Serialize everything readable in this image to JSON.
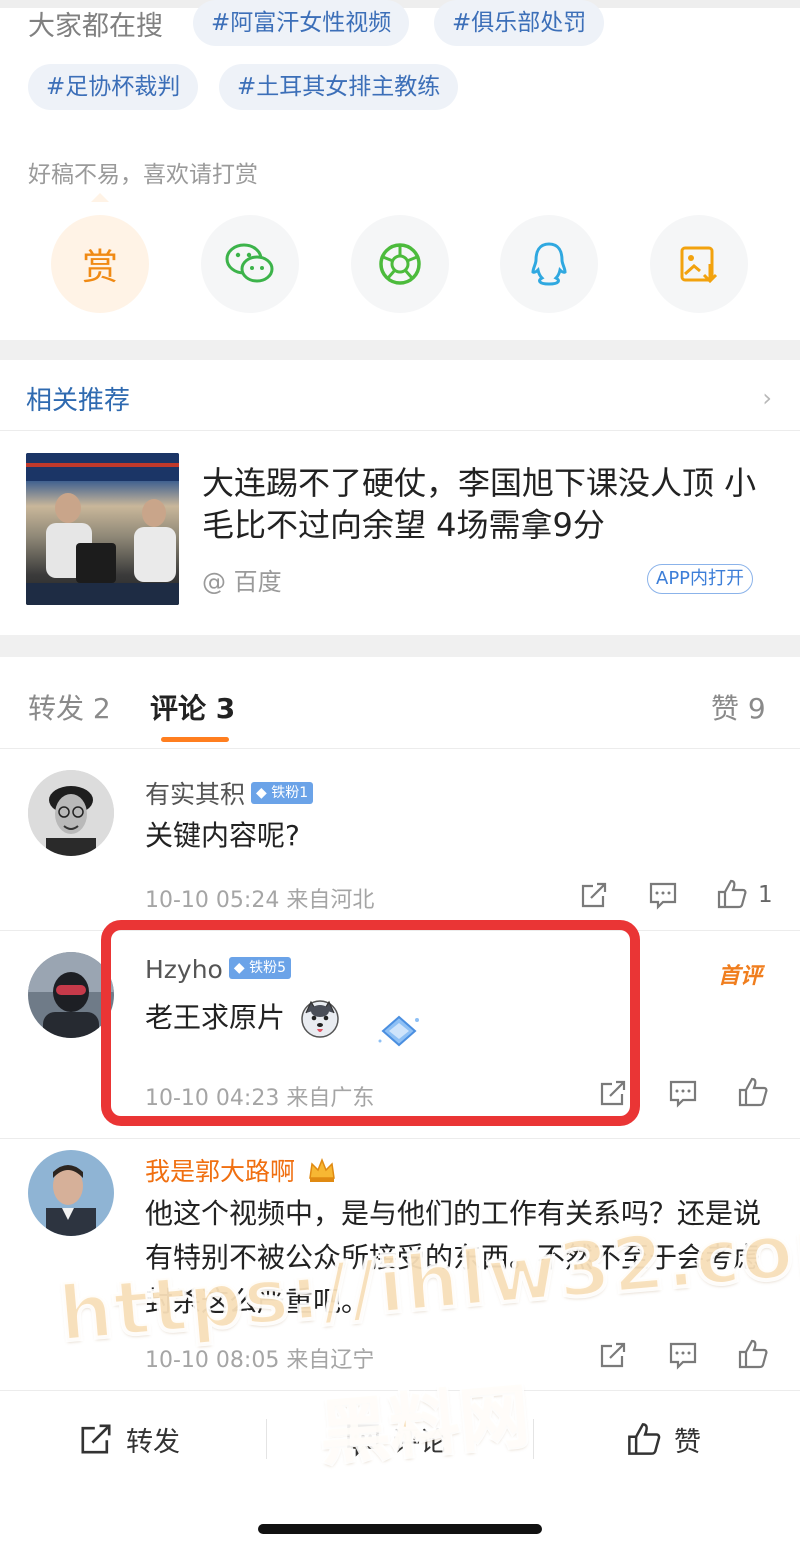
{
  "hot_search": {
    "label": "大家都在搜",
    "tags": [
      "#阿富汗女性视频",
      "#俱乐部处罚",
      "#足协杯裁判",
      "#土耳其女排主教练"
    ]
  },
  "reward": {
    "tip": "好稿不易，喜欢请打赏",
    "reward_label": "赏",
    "share_icons": [
      "wechat-icon",
      "moments-icon",
      "qq-icon",
      "save-image-icon"
    ]
  },
  "related": {
    "title": "相关推荐",
    "headline": "大连踢不了硬仗，李国旭下课没人顶 小毛比不过向余望 4场需拿9分",
    "source": "@ 百度",
    "open_app": "APP内打开"
  },
  "tabs": {
    "repost": "转发 2",
    "comment": "评论 3",
    "like": "赞 9"
  },
  "comments": [
    {
      "name": "有实其积",
      "badge": "铁粉1",
      "text": "关键内容呢?",
      "meta": "10-10 05:24 来自河北",
      "likes": "1"
    },
    {
      "name": "Hzyho",
      "badge": "铁粉5",
      "text": "老王求原片",
      "meta": "10-10 04:23 来自广东",
      "tag": "首评"
    },
    {
      "name": "我是郭大路啊",
      "text": "他这个视频中，是与他们的工作有关系吗？还是说有特别不被公众所接受的东西。不然不至于会考虑封杀这么严重吧。",
      "meta": "10-10 08:05 来自辽宁"
    }
  ],
  "bottom_bar": {
    "repost": "转发",
    "comment": "评论",
    "like": "赞"
  },
  "watermark": {
    "line1": "https://ihlw32.com",
    "line2": "黑料网"
  },
  "colors": {
    "accent_orange": "#ff7e1f",
    "link_blue": "#2f6ab0",
    "highlight_red": "#ea3535"
  }
}
